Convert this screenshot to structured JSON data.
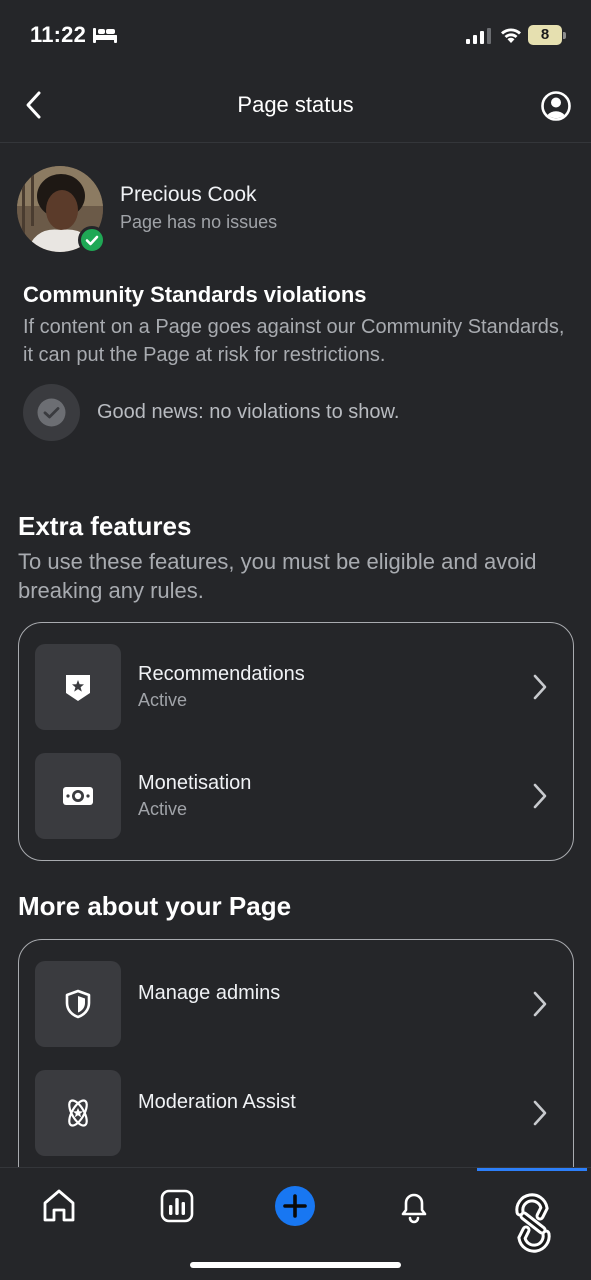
{
  "status_bar": {
    "time": "11:22",
    "battery": "8"
  },
  "nav": {
    "title": "Page status"
  },
  "profile": {
    "name": "Precious Cook",
    "status": "Page has no issues"
  },
  "community": {
    "heading": "Community Standards violations",
    "description": "If content on a Page goes against our Community Standards, it can put the Page at risk for restrictions.",
    "good_news": "Good news: no violations to show."
  },
  "extra_features": {
    "heading": "Extra features",
    "description": "To use these features, you must be eligible and avoid breaking any rules.",
    "items": [
      {
        "title": "Recommendations",
        "subtitle": "Active",
        "icon": "star-badge-icon"
      },
      {
        "title": "Monetisation",
        "subtitle": "Active",
        "icon": "money-icon"
      }
    ]
  },
  "more_about": {
    "heading": "More about your Page",
    "items": [
      {
        "title": "Manage admins",
        "icon": "shield-icon"
      },
      {
        "title": "Moderation Assist",
        "icon": "atom-star-icon"
      }
    ]
  },
  "tabs": [
    "home",
    "insights",
    "create",
    "notifications",
    "profile"
  ],
  "colors": {
    "background": "#252629",
    "accent": "#2d7ff9",
    "success": "#1fa855"
  }
}
